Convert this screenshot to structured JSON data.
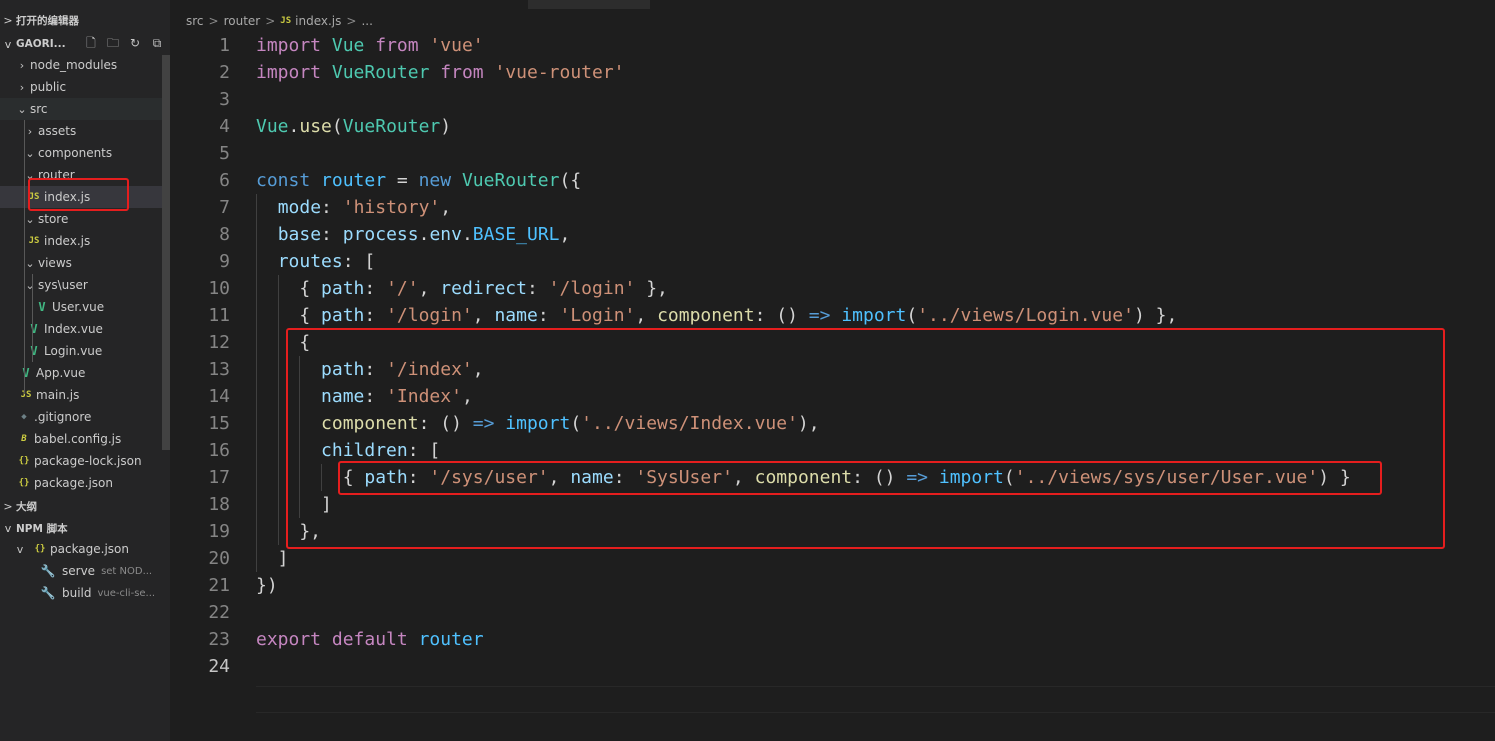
{
  "sidebar": {
    "open_editors_label": "打开的编辑器",
    "project_label": "GAORI...",
    "outline_label": "大纲",
    "npm_label": "NPM 脚本",
    "tree": [
      {
        "label": "node_modules",
        "chev": ">",
        "icon": "",
        "level": 0
      },
      {
        "label": "public",
        "chev": ">",
        "icon": "",
        "level": 0
      },
      {
        "label": "src",
        "chev": "v",
        "icon": "",
        "level": 0
      },
      {
        "label": "assets",
        "chev": ">",
        "icon": "",
        "level": 1
      },
      {
        "label": "components",
        "chev": "v",
        "icon": "",
        "level": 1
      },
      {
        "label": "router",
        "chev": "v",
        "icon": "",
        "level": 1
      },
      {
        "label": "index.js",
        "chev": "",
        "icon": "JS",
        "level": 2
      },
      {
        "label": "store",
        "chev": "v",
        "icon": "",
        "level": 1
      },
      {
        "label": "index.js",
        "chev": "",
        "icon": "JS",
        "level": 2
      },
      {
        "label": "views",
        "chev": "v",
        "icon": "",
        "level": 1
      },
      {
        "label": "sys\\user",
        "chev": "v",
        "icon": "",
        "level": 2
      },
      {
        "label": "User.vue",
        "chev": "",
        "icon": "V",
        "level": 3
      },
      {
        "label": "Index.vue",
        "chev": "",
        "icon": "V",
        "level": 2
      },
      {
        "label": "Login.vue",
        "chev": "",
        "icon": "V",
        "level": 2
      },
      {
        "label": "App.vue",
        "chev": "",
        "icon": "V",
        "level": 1
      },
      {
        "label": "main.js",
        "chev": "",
        "icon": "JS",
        "level": 1
      },
      {
        "label": ".gitignore",
        "chev": "",
        "icon": "◆",
        "level": 0
      },
      {
        "label": "babel.config.js",
        "chev": "",
        "icon": "B",
        "level": 0
      },
      {
        "label": "package-lock.json",
        "chev": "",
        "icon": "{}",
        "level": 0
      },
      {
        "label": "package.json",
        "chev": "",
        "icon": "{}",
        "level": 0
      }
    ],
    "npm": {
      "file": "package.json",
      "file_icon": "{}",
      "scripts": [
        {
          "name": "serve",
          "cmd": "set NOD..."
        },
        {
          "name": "build",
          "cmd": "vue-cli-se..."
        }
      ]
    }
  },
  "breadcrumb": {
    "parts": [
      "src",
      "router",
      "index.js",
      "..."
    ],
    "file_icon": "JS"
  },
  "editor": {
    "active_line": "24",
    "line_numbers": [
      "1",
      "2",
      "3",
      "4",
      "5",
      "6",
      "7",
      "8",
      "9",
      "10",
      "11",
      "12",
      "13",
      "14",
      "15",
      "16",
      "17",
      "18",
      "19",
      "20",
      "21",
      "22",
      "23",
      "24"
    ],
    "code": [
      [
        [
          "kw",
          "import"
        ],
        [
          "pn",
          " "
        ],
        [
          "cls",
          "Vue"
        ],
        [
          "pn",
          " "
        ],
        [
          "kw",
          "from"
        ],
        [
          "pn",
          " "
        ],
        [
          "str",
          "'vue'"
        ]
      ],
      [
        [
          "kw",
          "import"
        ],
        [
          "pn",
          " "
        ],
        [
          "cls",
          "VueRouter"
        ],
        [
          "pn",
          " "
        ],
        [
          "kw",
          "from"
        ],
        [
          "pn",
          " "
        ],
        [
          "str",
          "'vue-router'"
        ]
      ],
      [],
      [
        [
          "cls",
          "Vue"
        ],
        [
          "pn",
          "."
        ],
        [
          "fn",
          "use"
        ],
        [
          "pn",
          "("
        ],
        [
          "cls",
          "VueRouter"
        ],
        [
          "pn",
          ")"
        ]
      ],
      [],
      [
        [
          "kwb",
          "const"
        ],
        [
          "pn",
          " "
        ],
        [
          "cst",
          "router"
        ],
        [
          "pn",
          " = "
        ],
        [
          "kwb",
          "new"
        ],
        [
          "pn",
          " "
        ],
        [
          "cls",
          "VueRouter"
        ],
        [
          "pn",
          "({"
        ]
      ],
      [
        [
          "pn",
          "  "
        ],
        [
          "prop",
          "mode"
        ],
        [
          "pn",
          ": "
        ],
        [
          "str",
          "'history'"
        ],
        [
          "pn",
          ","
        ]
      ],
      [
        [
          "pn",
          "  "
        ],
        [
          "prop",
          "base"
        ],
        [
          "pn",
          ": "
        ],
        [
          "prop",
          "process"
        ],
        [
          "pn",
          "."
        ],
        [
          "prop",
          "env"
        ],
        [
          "pn",
          "."
        ],
        [
          "cst",
          "BASE_URL"
        ],
        [
          "pn",
          ","
        ]
      ],
      [
        [
          "pn",
          "  "
        ],
        [
          "prop",
          "routes"
        ],
        [
          "pn",
          ": ["
        ]
      ],
      [
        [
          "pn",
          "    { "
        ],
        [
          "prop",
          "path"
        ],
        [
          "pn",
          ": "
        ],
        [
          "str",
          "'/'"
        ],
        [
          "pn",
          ", "
        ],
        [
          "prop",
          "redirect"
        ],
        [
          "pn",
          ": "
        ],
        [
          "str",
          "'/login'"
        ],
        [
          "pn",
          " },"
        ]
      ],
      [
        [
          "pn",
          "    { "
        ],
        [
          "prop",
          "path"
        ],
        [
          "pn",
          ": "
        ],
        [
          "str",
          "'/login'"
        ],
        [
          "pn",
          ", "
        ],
        [
          "prop",
          "name"
        ],
        [
          "pn",
          ": "
        ],
        [
          "str",
          "'Login'"
        ],
        [
          "pn",
          ", "
        ],
        [
          "fn",
          "component"
        ],
        [
          "pn",
          ": () "
        ],
        [
          "kwb",
          "=>"
        ],
        [
          "pn",
          " "
        ],
        [
          "imp",
          "import"
        ],
        [
          "pn",
          "("
        ],
        [
          "str",
          "'../views/Login.vue'"
        ],
        [
          "pn",
          ") },"
        ]
      ],
      [
        [
          "pn",
          "    {"
        ]
      ],
      [
        [
          "pn",
          "      "
        ],
        [
          "prop",
          "path"
        ],
        [
          "pn",
          ": "
        ],
        [
          "str",
          "'/index'"
        ],
        [
          "pn",
          ","
        ]
      ],
      [
        [
          "pn",
          "      "
        ],
        [
          "prop",
          "name"
        ],
        [
          "pn",
          ": "
        ],
        [
          "str",
          "'Index'"
        ],
        [
          "pn",
          ","
        ]
      ],
      [
        [
          "pn",
          "      "
        ],
        [
          "fn",
          "component"
        ],
        [
          "pn",
          ": () "
        ],
        [
          "kwb",
          "=>"
        ],
        [
          "pn",
          " "
        ],
        [
          "imp",
          "import"
        ],
        [
          "pn",
          "("
        ],
        [
          "str",
          "'../views/Index.vue'"
        ],
        [
          "pn",
          "),"
        ]
      ],
      [
        [
          "pn",
          "      "
        ],
        [
          "prop",
          "children"
        ],
        [
          "pn",
          ": ["
        ]
      ],
      [
        [
          "pn",
          "        { "
        ],
        [
          "prop",
          "path"
        ],
        [
          "pn",
          ": "
        ],
        [
          "str",
          "'/sys/user'"
        ],
        [
          "pn",
          ", "
        ],
        [
          "prop",
          "name"
        ],
        [
          "pn",
          ": "
        ],
        [
          "str",
          "'SysUser'"
        ],
        [
          "pn",
          ", "
        ],
        [
          "fn",
          "component"
        ],
        [
          "pn",
          ": () "
        ],
        [
          "kwb",
          "=>"
        ],
        [
          "pn",
          " "
        ],
        [
          "imp",
          "import"
        ],
        [
          "pn",
          "("
        ],
        [
          "str",
          "'../views/sys/user/User.vue'"
        ],
        [
          "pn",
          ") }"
        ]
      ],
      [
        [
          "pn",
          "      ]"
        ]
      ],
      [
        [
          "pn",
          "    },"
        ]
      ],
      [
        [
          "pn",
          "  ]"
        ]
      ],
      [
        [
          "pn",
          "})"
        ]
      ],
      [],
      [
        [
          "kw",
          "export"
        ],
        [
          "pn",
          " "
        ],
        [
          "kw",
          "default"
        ],
        [
          "pn",
          " "
        ],
        [
          "cst",
          "router"
        ]
      ],
      []
    ]
  },
  "colors": {
    "annotation_red": "#e51e1e",
    "keyword": "#c586c0",
    "class": "#4ec9b0",
    "string": "#ce9178"
  }
}
